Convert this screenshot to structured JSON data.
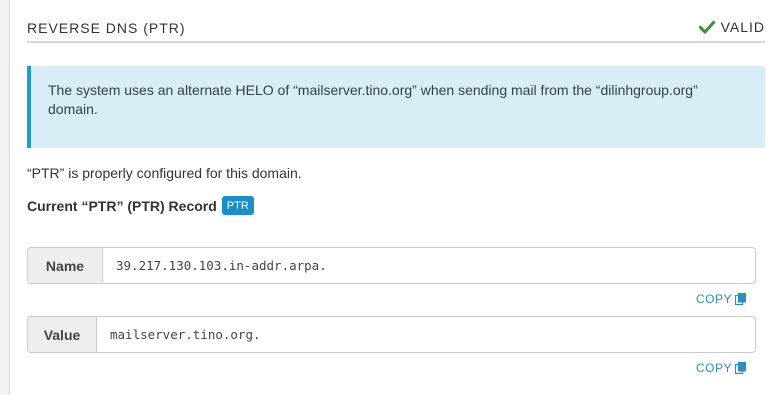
{
  "section": {
    "title": "REVERSE DNS (PTR)",
    "status": "VALID",
    "status_color": "#3c8d3c"
  },
  "alert": {
    "text": "The system uses an alternate HELO of “mailserver.tino.org” when sending mail from the “dilinhgroup.org” domain."
  },
  "configured_text": "“PTR” is properly configured for this domain.",
  "record": {
    "title": "Current “PTR” (PTR) Record",
    "badge": "PTR"
  },
  "fields": {
    "name_label": "Name",
    "name_value": "39.217.130.103.in-addr.arpa.",
    "value_label": "Value",
    "value_value": "mailserver.tino.org."
  },
  "copy_label": "COPY",
  "icons": {
    "status": "check-icon",
    "copy": "copy-icon"
  }
}
